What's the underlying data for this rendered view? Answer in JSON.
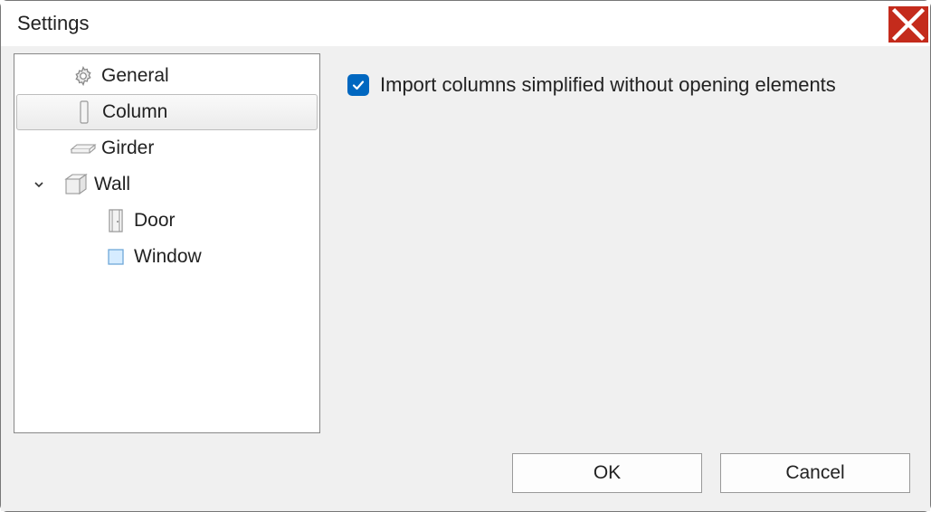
{
  "window": {
    "title": "Settings"
  },
  "tree": {
    "general": "General",
    "column": "Column",
    "girder": "Girder",
    "wall": "Wall",
    "door": "Door",
    "window": "Window"
  },
  "content": {
    "import_simplified": "Import columns simplified without opening elements"
  },
  "buttons": {
    "ok": "OK",
    "cancel": "Cancel"
  }
}
